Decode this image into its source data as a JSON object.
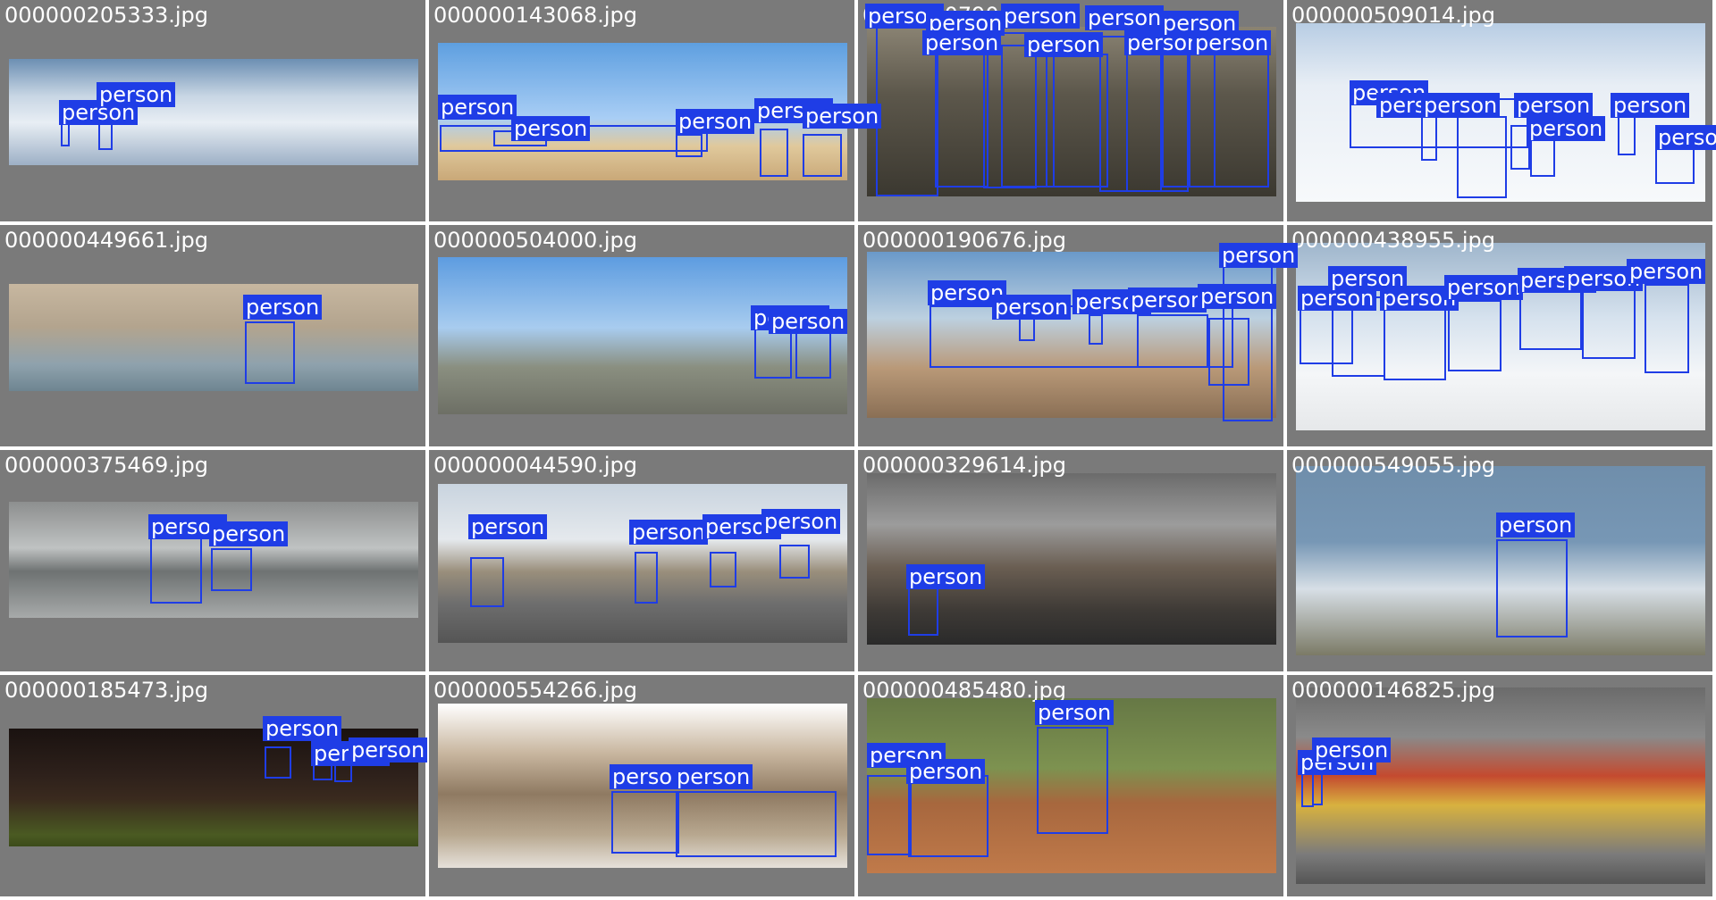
{
  "detection_label": "person",
  "colors": {
    "box": "#1f3de6",
    "background": "#7a7a7a"
  },
  "tiles": [
    {
      "filename": "000000205333.jpg"
    },
    {
      "filename": "000000143068.jpg"
    },
    {
      "filename": "000000079046.jpg"
    },
    {
      "filename": "000000509014.jpg"
    },
    {
      "filename": "000000449661.jpg"
    },
    {
      "filename": "000000504000.jpg"
    },
    {
      "filename": "000000190676.jpg"
    },
    {
      "filename": "000000438955.jpg"
    },
    {
      "filename": "000000375469.jpg"
    },
    {
      "filename": "000000044590.jpg"
    },
    {
      "filename": "000000329614.jpg"
    },
    {
      "filename": "000000549055.jpg"
    },
    {
      "filename": "000000185473.jpg"
    },
    {
      "filename": "000000554266.jpg"
    },
    {
      "filename": "000000485480.jpg"
    },
    {
      "filename": "000000146825.jpg"
    }
  ]
}
